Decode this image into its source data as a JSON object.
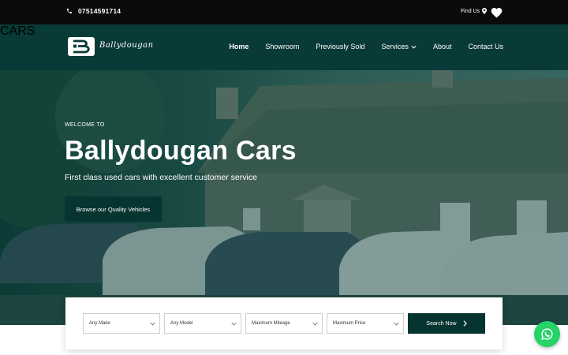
{
  "topbar": {
    "phone": "07514591714",
    "find_us": "Find Us"
  },
  "brand": {
    "name": "Ballydougan",
    "sub": "CARS"
  },
  "nav": {
    "items": [
      {
        "label": "Home",
        "active": true
      },
      {
        "label": "Showroom"
      },
      {
        "label": "Previously Sold"
      },
      {
        "label": "Services",
        "dropdown": true
      },
      {
        "label": "About"
      },
      {
        "label": "Contact Us"
      }
    ]
  },
  "hero": {
    "welcome": "WELCOME TO",
    "title": "Ballydougan Cars",
    "tagline": "First class used cars with excellent customer service",
    "cta": "Browse our Quality Vehicles"
  },
  "search": {
    "make": "Any Make",
    "model": "Any Model",
    "mileage": "Maximum Mileage",
    "price": "Maximum Price",
    "button": "Search Now"
  },
  "colors": {
    "topbar": "#0b0b0b",
    "navbar": "#083a37",
    "accent": "#063430",
    "whatsapp": "#25d366"
  },
  "icons": [
    "phone-icon",
    "map-pin-icon",
    "heart-icon",
    "chevron-down-icon",
    "chevron-right-icon",
    "whatsapp-icon"
  ]
}
